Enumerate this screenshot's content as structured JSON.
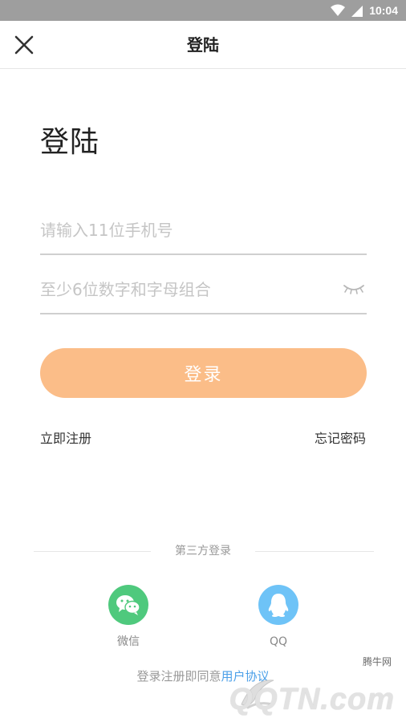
{
  "status_bar": {
    "time": "10:04"
  },
  "app_bar": {
    "title": "登陆"
  },
  "page": {
    "heading": "登陆",
    "phone_placeholder": "请输入11位手机号",
    "password_placeholder": "至少6位数字和字母组合",
    "login_label": "登录",
    "register_label": "立即注册",
    "forgot_label": "忘记密码"
  },
  "third_party": {
    "label": "第三方登录",
    "wechat_label": "微信",
    "qq_label": "QQ"
  },
  "agreement": {
    "prefix": "登录注册即同意",
    "link": "用户协议"
  },
  "watermark": {
    "small": "腾牛网",
    "brand": "QQTN.com"
  },
  "colors": {
    "login_button": "#fbbd88",
    "wechat": "#4fc97d",
    "qq": "#6ec3f7",
    "link": "#4a9fe8",
    "status_bar": "#9e9e9e"
  }
}
